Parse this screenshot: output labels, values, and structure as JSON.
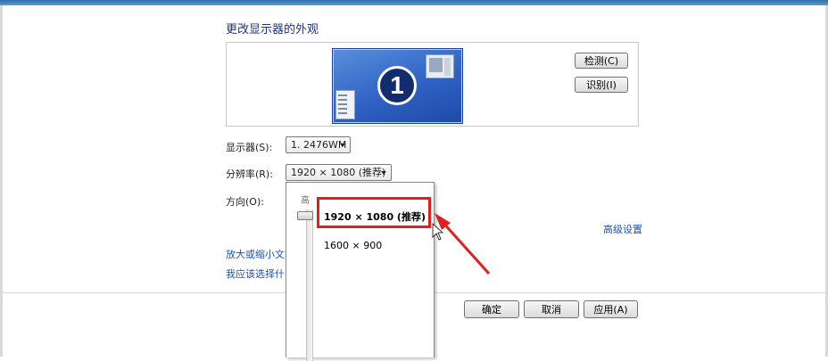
{
  "panel": {
    "title": "更改显示器的外观"
  },
  "preview": {
    "monitor_number": "1",
    "detect_label": "检测(C)",
    "identify_label": "识别(I)"
  },
  "fields": {
    "display_label": "显示器(S):",
    "display_value": "1. 2476WM",
    "resolution_label": "分辨率(R):",
    "resolution_value": "1920 × 1080 (推荐)",
    "orientation_label": "方向(O):"
  },
  "dropdown": {
    "slider_high_label": "高",
    "options": [
      "1920 × 1080 (推荐)",
      "1600 × 900"
    ]
  },
  "links": {
    "advanced": "高级设置",
    "text_size": "放大或缩小文本",
    "which": "我应该选择什么"
  },
  "footer": {
    "ok_label": "确定",
    "cancel_label": "取消",
    "apply_label": "应用(A)"
  },
  "colors": {
    "highlight": "#e02020",
    "link": "#1e51b4",
    "title": "#1e3287"
  }
}
